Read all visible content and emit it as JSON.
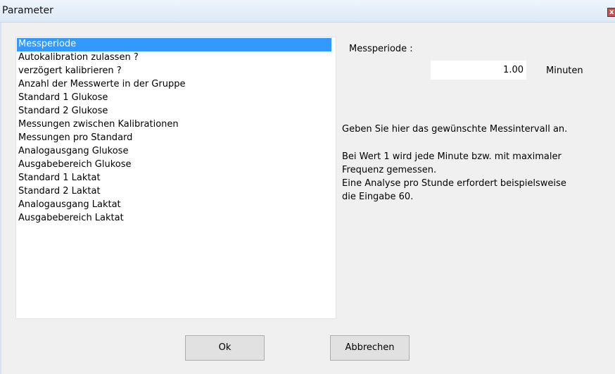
{
  "window": {
    "title": "Parameter",
    "close_glyph": "x"
  },
  "parameter_list": {
    "items": [
      {
        "label": "Messperiode",
        "selected": true
      },
      {
        "label": "Autokalibration zulassen ?",
        "selected": false
      },
      {
        "label": "verzögert kalibrieren ?",
        "selected": false
      },
      {
        "label": "Anzahl der Messwerte in der Gruppe",
        "selected": false
      },
      {
        "label": "Standard 1 Glukose",
        "selected": false
      },
      {
        "label": "Standard 2 Glukose",
        "selected": false
      },
      {
        "label": "Messungen zwischen Kalibrationen",
        "selected": false
      },
      {
        "label": "Messungen pro Standard",
        "selected": false
      },
      {
        "label": "Analogausgang Glukose",
        "selected": false
      },
      {
        "label": "Ausgabebereich Glukose",
        "selected": false
      },
      {
        "label": "Standard 1 Laktat",
        "selected": false
      },
      {
        "label": "Standard 2 Laktat",
        "selected": false
      },
      {
        "label": "Analogausgang Laktat",
        "selected": false
      },
      {
        "label": "Ausgabebereich Laktat",
        "selected": false
      }
    ]
  },
  "editor": {
    "label": "Messperiode :",
    "value": "1.00",
    "unit": "Minuten"
  },
  "help": {
    "line1": "Geben Sie hier das gewünschte Messintervall an.",
    "lines": [
      "Bei Wert 1 wird jede Minute bzw. mit maximaler",
      "Frequenz gemessen.",
      "Eine Analyse pro Stunde erfordert beispielsweise",
      "die Eingabe 60."
    ]
  },
  "buttons": {
    "ok": "Ok",
    "cancel": "Abbrechen"
  },
  "colors": {
    "selection": "#3399ff",
    "dialog_bg": "#f0f0f0"
  }
}
